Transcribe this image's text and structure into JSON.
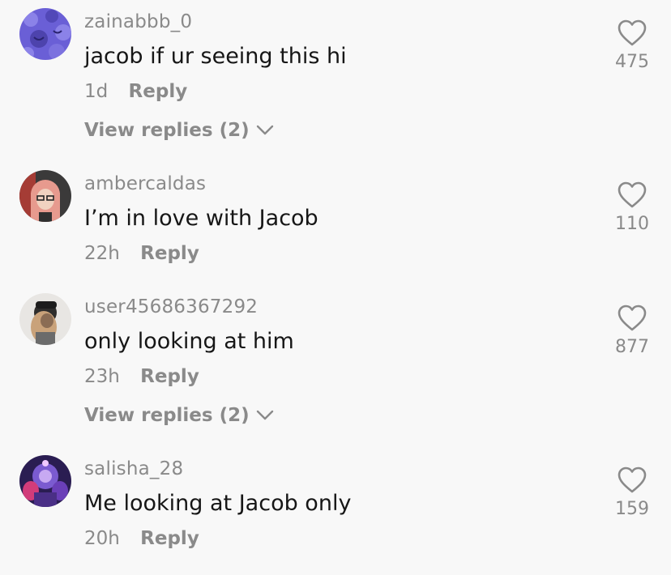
{
  "comments": [
    {
      "username": "zainabbb_0",
      "text": "jacob if ur seeing this hi",
      "time": "1d",
      "reply_label": "Reply",
      "likes": "475",
      "view_replies": "View replies (2)",
      "avatar_color": "#6a5fd6"
    },
    {
      "username": "ambercaldas",
      "text": "I’m in love with Jacob",
      "time": "22h",
      "reply_label": "Reply",
      "likes": "110",
      "avatar_color": "#c98f86"
    },
    {
      "username": "user45686367292",
      "text": "only looking at him",
      "time": "23h",
      "reply_label": "Reply",
      "likes": "877",
      "view_replies": "View replies (2)",
      "avatar_color": "#8d7864"
    },
    {
      "username": "salisha_28",
      "text": "Me looking at Jacob only",
      "time": "20h",
      "reply_label": "Reply",
      "likes": "159",
      "avatar_color": "#5a3f92"
    }
  ],
  "icons": {
    "like": "heart-outline-icon",
    "expand": "chevron-down-icon"
  }
}
